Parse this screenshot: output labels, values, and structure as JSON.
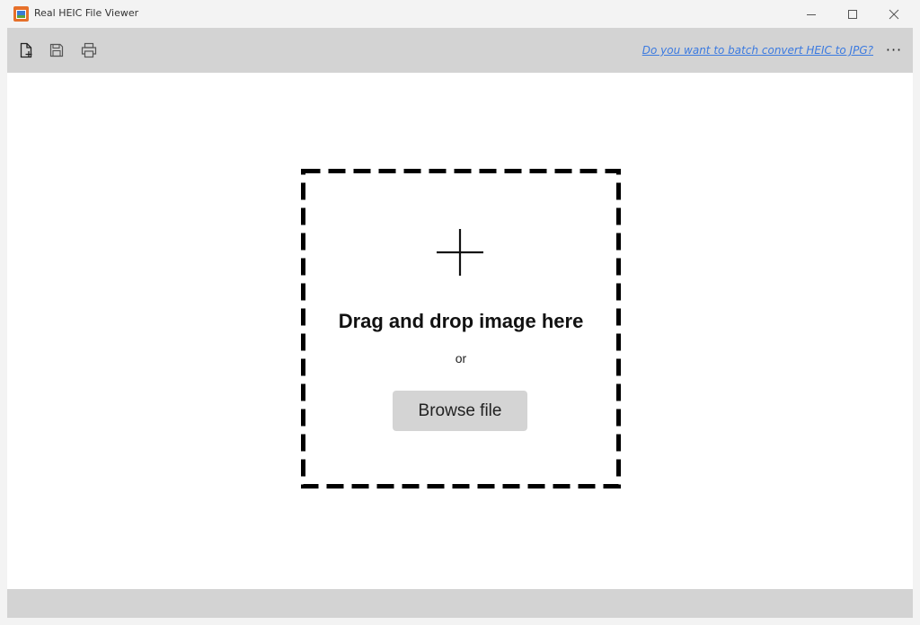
{
  "window": {
    "title": "Real HEIC File Viewer"
  },
  "toolbar": {
    "buttons": [
      {
        "icon": "new-file-icon"
      },
      {
        "icon": "save-icon"
      },
      {
        "icon": "print-icon"
      }
    ],
    "batch_link": "Do you want to batch convert HEIC to JPG?",
    "more_label": "···"
  },
  "dropzone": {
    "title": "Drag and drop image here",
    "or": "or",
    "browse_label": "Browse file"
  },
  "colors": {
    "toolbar_bg": "#d3d3d3",
    "link": "#3b7ae0",
    "button_bg": "#d4d4d4",
    "content_bg": "#ffffff"
  }
}
